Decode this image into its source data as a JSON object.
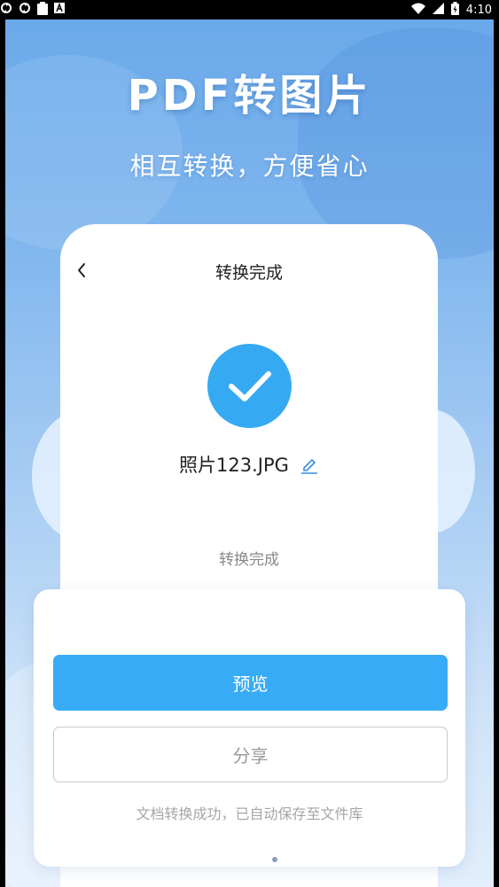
{
  "status_bar": {
    "time": "4:10",
    "icons": [
      "sync-icon",
      "sync-icon",
      "clipboard-icon",
      "a-badge-icon",
      "wifi-icon",
      "signal-icon",
      "battery-icon"
    ]
  },
  "promo": {
    "headline": "PDF转图片",
    "subline": "相互转换，方便省心"
  },
  "screen": {
    "title": "转换完成",
    "file_name": "照片123.JPG",
    "status": "转换完成"
  },
  "sheet": {
    "preview_label": "预览",
    "share_label": "分享",
    "hint": "文档转换成功，已自动保存至文件库"
  },
  "colors": {
    "accent": "#37abf5",
    "check_circle": "#35aaf2",
    "edit_icon": "#3b8fe0"
  }
}
